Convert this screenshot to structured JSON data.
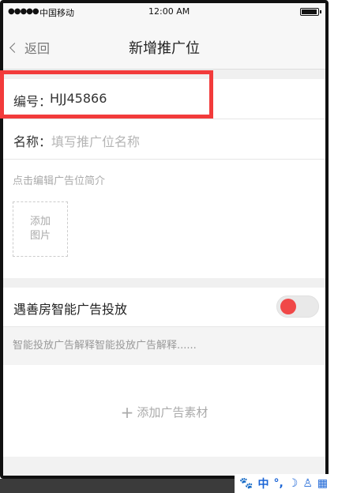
{
  "status_bar": {
    "signal": "●●●●●",
    "carrier": "中国移动",
    "time": "12:00 AM"
  },
  "nav": {
    "back_label": "返回",
    "title": "新增推广位"
  },
  "form": {
    "code_label": "编号：",
    "code_value": "HJJ45866",
    "name_label": "名称：",
    "name_placeholder": "填写推广位名称"
  },
  "intro": {
    "hint": "点击编辑广告位简介",
    "add_image_line1": "添加",
    "add_image_line2": "图片"
  },
  "smart_ad": {
    "label": "遇善房智能广告投放",
    "toggle_on": true,
    "description": "智能投放广告解释智能投放广告解释......"
  },
  "material": {
    "plus": "+",
    "add_label": "添加广告素材"
  },
  "ime_toolbar": {
    "paw": "🐾",
    "mode": "中",
    "punct": "°,",
    "moon": "☽",
    "user": "♙",
    "grid": "▦"
  },
  "colors": {
    "highlight": "#f23b3b",
    "toggle_knob": "#f04848"
  }
}
